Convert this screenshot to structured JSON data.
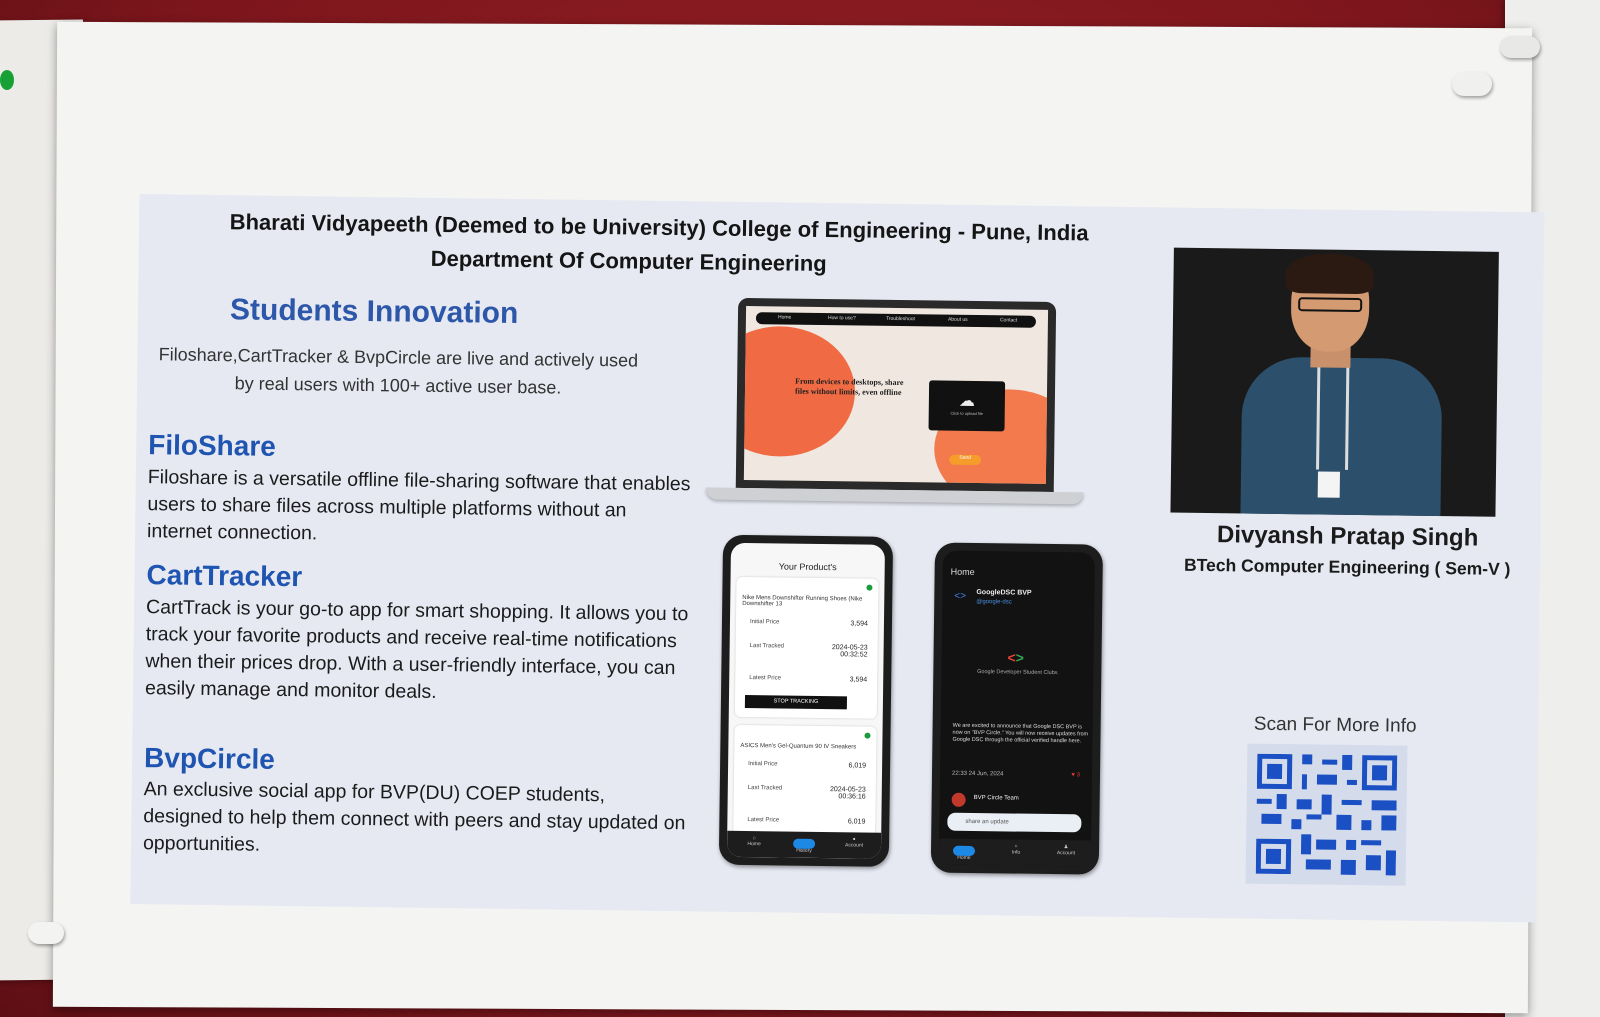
{
  "header": {
    "institution": "Bharati Vidyapeeth (Deemed to be University) College of Engineering - Pune, India",
    "department": "Department Of Computer Engineering"
  },
  "innovation": {
    "title": "Students Innovation",
    "description": "Filoshare,CartTracker & BvpCircle  are live and actively used by real users with 100+ active user base."
  },
  "sections": [
    {
      "title": "FiloShare",
      "text": "Filoshare is a versatile offline file-sharing software that enables users to share files across multiple platforms without an internet connection."
    },
    {
      "title": "CartTracker",
      "text": "CartTrack is your go-to app for smart shopping. It allows you to track your favorite products and receive real-time notifications when their prices drop. With a user-friendly interface, you can easily manage and monitor deals."
    },
    {
      "title": "BvpCircle",
      "text": "An exclusive social app for BVP(DU) COEP students, designed to help them connect with peers and stay updated on opportunities."
    }
  ],
  "laptop": {
    "nav": [
      "Home",
      "How to use?",
      "Troubleshoot",
      "About us",
      "Contact"
    ],
    "headline": "From devices to desktops, share files without limits, even offline",
    "upload_caption": "Click to upload file",
    "send_label": "Send"
  },
  "cart_phone": {
    "title": "Your Product's",
    "products": [
      {
        "name": "Nike Mens Downshifter Running Shoes (Nike Downshifter 13",
        "initial_label": "Initial Price",
        "initial": "3,594",
        "tracked_label": "Last Tracked",
        "tracked": "2024-05-23 00:32:52",
        "latest_label": "Latest Price",
        "latest": "3,594",
        "button": "STOP TRACKING"
      },
      {
        "name": "ASICS Men's Gel-Quantum 90 IV Sneakers",
        "initial_label": "Initial Price",
        "initial": "6,019",
        "tracked_label": "Last Tracked",
        "tracked": "2024-05-23 00:36:16",
        "latest_label": "Latest Price",
        "latest": "6,019"
      }
    ],
    "tabs": [
      "Home",
      "History",
      "Account"
    ]
  },
  "circle_phone": {
    "screen_title": "Home",
    "account_name": "GoogleDSC BVP",
    "account_handle": "@google-dsc",
    "card_title": "Google Developer Student Clubs",
    "post": "We are excited to announce that Google DSC BVP is now on \"BVP Circle.\" You will now receive updates from Google DSC through the official verified handle here.",
    "timestamp": "22:33 24 Jun, 2024",
    "likes": "3",
    "team_name": "BVP Circle Team",
    "input_placeholder": "share an update",
    "tabs": [
      "Home",
      "Info",
      "Account"
    ]
  },
  "profile": {
    "name": "Divyansh Pratap Singh",
    "role": "BTech Computer Engineering ( Sem-V )"
  },
  "qr": {
    "label": "Scan For More Info",
    "color": "#1b4fc4"
  },
  "colors": {
    "accent": "#2d57a8",
    "board": "#8a1c22",
    "poster": "#e6e9f2"
  }
}
